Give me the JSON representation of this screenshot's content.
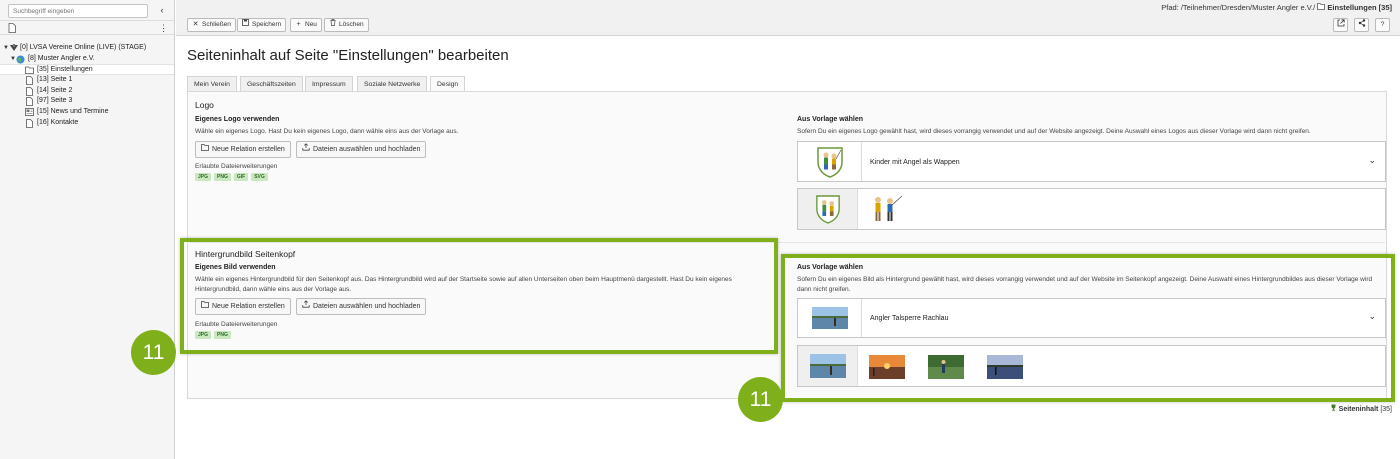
{
  "sidebar": {
    "search_placeholder": "Suchbegriff eingeben",
    "tree": [
      {
        "label": "[0] LVSA Vereine Online (LIVE) (STAGE)",
        "icon": "site-root-icon"
      },
      {
        "label": "[8] Muster Angler e.V.",
        "icon": "globe-icon"
      },
      {
        "label": "[35] Einstellungen",
        "icon": "folder-icon"
      },
      {
        "label": "[13] Seite 1",
        "icon": "page-icon"
      },
      {
        "label": "[14] Seite 2",
        "icon": "page-icon"
      },
      {
        "label": "[97] Seite 3",
        "icon": "page-icon"
      },
      {
        "label": "[15] News und Termine",
        "icon": "news-folder-icon"
      },
      {
        "label": "[16] Kontakte",
        "icon": "page-icon"
      }
    ]
  },
  "toolbar": {
    "close_label": "Schließen",
    "save_label": "Speichern",
    "new_label": "Neu",
    "delete_label": "Löschen"
  },
  "breadcrumb": {
    "prefix": "Pfad: /Teilnehmer/Dresden/Muster Angler e.V./",
    "page": "Einstellungen [35]"
  },
  "main": {
    "title": "Seiteninhalt auf Seite \"Einstellungen\" bearbeiten",
    "tabs": [
      "Mein Verein",
      "Geschäftszeiten",
      "Impressum",
      "Soziale Netzwerke",
      "Design"
    ],
    "active_tab": "Design"
  },
  "logo": {
    "section_title": "Logo",
    "own_title": "Eigenes Logo verwenden",
    "own_desc": "Wähle ein eigenes Logo. Hast Du kein eigenes Logo, dann wähle eins aus der Vorlage aus.",
    "btn_new_relation": "Neue Relation erstellen",
    "btn_upload": "Dateien auswählen und hochladen",
    "ext_label": "Erlaubte Dateierweiterungen",
    "extensions": [
      "JPG",
      "PNG",
      "GIF",
      "SVG"
    ],
    "template_title": "Aus Vorlage wählen",
    "template_desc": "Sofern Du ein eigenes Logo gewählt hast, wird dieses vorrangig verwendet und auf der Website angezeigt. Deine Auswahl eines Logos aus dieser Vorlage wird dann nicht greifen.",
    "selected": "Kinder mit Angel als Wappen"
  },
  "header_image": {
    "section_title": "Hintergrundbild Seitenkopf",
    "own_title": "Eigenes Bild verwenden",
    "own_desc": "Wähle ein eigenes Hintergrundbild für den Seitenkopf aus. Das Hintergrundbild wird auf der Startseite sowie auf allen Unterseiten oben beim Hauptmenü dargestellt. Hast Du kein eigenes Hintergrundbild, dann wähle eins aus der Vorlage aus.",
    "btn_new_relation": "Neue Relation erstellen",
    "btn_upload": "Dateien auswählen und hochladen",
    "ext_label": "Erlaubte Dateierweiterungen",
    "extensions": [
      "JPG",
      "PNG"
    ],
    "template_title": "Aus Vorlage wählen",
    "template_desc": "Sofern Du ein eigenes Bild als Hintergrund gewählt hast, wird dieses vorrangig verwendet und auf der Website im Seitenkopf angezeigt. Deine Auswahl eines Hintergrundbildes aus dieser Vorlage wird dann nicht greifen.",
    "selected": "Angler Talsperre Rachlau"
  },
  "annotations": {
    "left_number": "11",
    "right_number": "11",
    "accent_color": "#7faf1b"
  },
  "footer": {
    "label": "Seiteninhalt",
    "id": "[35]"
  }
}
